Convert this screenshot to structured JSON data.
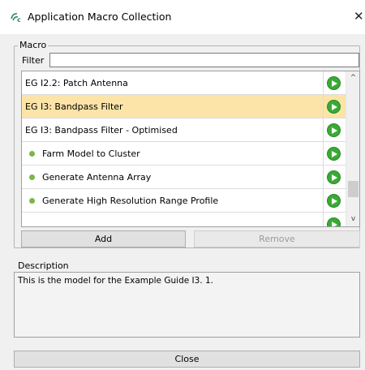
{
  "window": {
    "title": "Application Macro Collection",
    "close_glyph": "✕"
  },
  "macro_group": {
    "legend": "Macro",
    "filter_label": "Filter",
    "filter_value": ""
  },
  "macros": [
    {
      "label": "EG I2.2: Patch Antenna",
      "selected": false,
      "bullet": false
    },
    {
      "label": "EG I3: Bandpass Filter",
      "selected": true,
      "bullet": false
    },
    {
      "label": "EG I3: Bandpass Filter  - Optimised",
      "selected": false,
      "bullet": false
    },
    {
      "label": "Farm Model to Cluster",
      "selected": false,
      "bullet": true
    },
    {
      "label": "Generate Antenna Array",
      "selected": false,
      "bullet": true
    },
    {
      "label": "Generate High Resolution Range Profile",
      "selected": false,
      "bullet": true
    }
  ],
  "buttons": {
    "add": "Add",
    "remove": "Remove",
    "close": "Close"
  },
  "description_group": {
    "legend": "Description",
    "text": "This is the model for the Example Guide I3. 1."
  },
  "scrollbar": {
    "up_glyph": "^",
    "down_glyph": "v"
  },
  "colors": {
    "selected_row": "#fce4a8",
    "run_icon": "#3aaa35",
    "bullet": "#7ab648"
  },
  "icons": {
    "app": "feko-app-icon",
    "run": "play-circle-icon",
    "close": "close-icon"
  }
}
